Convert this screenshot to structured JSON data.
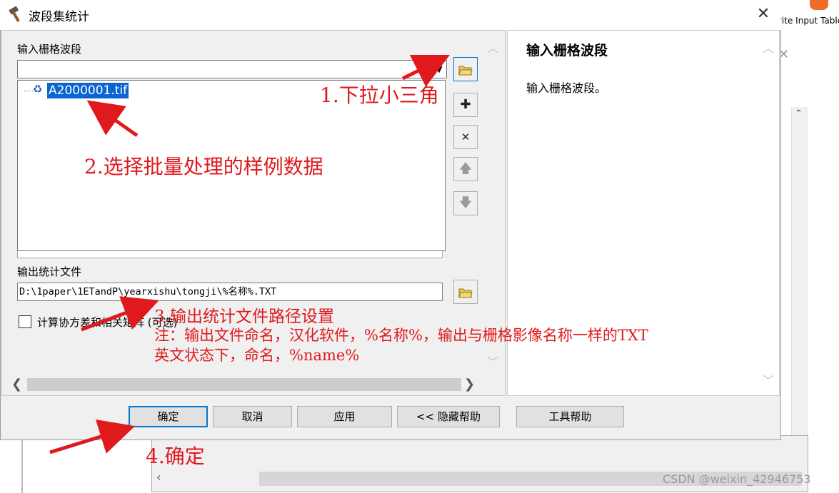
{
  "dialog": {
    "title": "波段集统计",
    "close_glyph": "✕"
  },
  "input_section": {
    "label": "输入栅格波段",
    "combo_value": "",
    "list_items": [
      "A2000001.tif"
    ]
  },
  "output_section": {
    "label": "输出统计文件",
    "value": "D:\\1paper\\1ETandP\\yearxishu\\tongji\\%名称%.TXT"
  },
  "checkbox": {
    "label": "计算协方差和相关矩阵 (可选)",
    "checked": false
  },
  "help_panel": {
    "title": "输入栅格波段",
    "body": "输入栅格波段。"
  },
  "buttons": {
    "ok": "确定",
    "cancel": "取消",
    "apply": "应用",
    "hide_help": "<< 隐藏帮助",
    "tool_help": "工具帮助"
  },
  "annotations": {
    "step1": "1.下拉小三角",
    "step2": "2.选择批量处理的样例数据",
    "step3": "3.输出统计文件路径设置",
    "note1": "注：输出文件命名，汉化软件，%名称%，输出与栅格影像名称一样的TXT",
    "note2": "英文状态下，命名，%name%",
    "step4": "4.确定"
  },
  "background": {
    "toolbar_text": "rite Input Table",
    "watermark": "CSDN @weixin_42946753"
  },
  "colors": {
    "annotation_red": "#e0191c",
    "selection_blue": "#0a64d2",
    "ok_border": "#0078d7"
  },
  "icons": [
    "hammer-icon",
    "folder-open-icon",
    "plus-icon",
    "remove-icon",
    "arrow-up-icon",
    "arrow-down-icon"
  ]
}
